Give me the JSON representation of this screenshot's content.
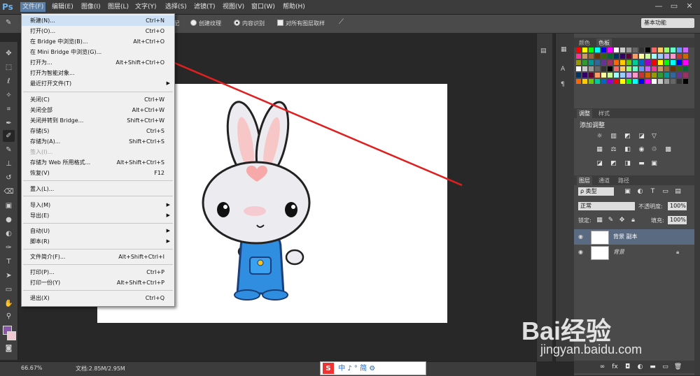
{
  "app": {
    "logo": "Ps"
  },
  "menubar": {
    "items": [
      "文件(F)",
      "编辑(E)",
      "图像(I)",
      "图层(L)",
      "文字(Y)",
      "选择(S)",
      "滤镜(T)",
      "视图(V)",
      "窗口(W)",
      "帮助(H)"
    ]
  },
  "window_controls": {
    "minimize": "—",
    "restore": "▭",
    "close": "✕"
  },
  "options": {
    "opt1": "配",
    "opt2": "创建纹理",
    "opt3": "内容识别",
    "opt4": "对所有图层取样",
    "workspace": "基本功能"
  },
  "file_menu": {
    "items": [
      {
        "label": "新建(N)...",
        "shortcut": "Ctrl+N"
      },
      {
        "label": "打开(O)...",
        "shortcut": "Ctrl+O"
      },
      {
        "label": "在 Bridge 中浏览(B)...",
        "shortcut": "Alt+Ctrl+O"
      },
      {
        "label": "在 Mini Bridge 中浏览(G)...",
        "shortcut": ""
      },
      {
        "label": "打开为...",
        "shortcut": "Alt+Shift+Ctrl+O"
      },
      {
        "label": "打开为智能对象...",
        "shortcut": ""
      },
      {
        "label": "最近打开文件(T)",
        "shortcut": ""
      },
      {
        "label": "关闭(C)",
        "shortcut": "Ctrl+W"
      },
      {
        "label": "关闭全部",
        "shortcut": "Alt+Ctrl+W"
      },
      {
        "label": "关闭并转到 Bridge...",
        "shortcut": "Shift+Ctrl+W"
      },
      {
        "label": "存储(S)",
        "shortcut": "Ctrl+S"
      },
      {
        "label": "存储为(A)...",
        "shortcut": "Shift+Ctrl+S"
      },
      {
        "label": "签入(I)...",
        "shortcut": ""
      },
      {
        "label": "存储为 Web 所用格式...",
        "shortcut": "Alt+Shift+Ctrl+S"
      },
      {
        "label": "恢复(V)",
        "shortcut": "F12"
      },
      {
        "label": "置入(L)...",
        "shortcut": ""
      },
      {
        "label": "导入(M)",
        "shortcut": ""
      },
      {
        "label": "导出(E)",
        "shortcut": ""
      },
      {
        "label": "自动(U)",
        "shortcut": ""
      },
      {
        "label": "脚本(R)",
        "shortcut": ""
      },
      {
        "label": "文件简介(F)...",
        "shortcut": "Alt+Shift+Ctrl+I"
      },
      {
        "label": "打印(P)...",
        "shortcut": "Ctrl+P"
      },
      {
        "label": "打印一份(Y)",
        "shortcut": "Alt+Shift+Ctrl+P"
      },
      {
        "label": "退出(X)",
        "shortcut": "Ctrl+Q"
      }
    ]
  },
  "panels": {
    "color_tabs": [
      "颜色",
      "色板"
    ],
    "adjust_tabs": [
      "调整",
      "样式"
    ],
    "adjust_title": "添加调整",
    "layers_tabs": [
      "图层",
      "通道",
      "路径"
    ],
    "filter_kind": "ρ 类型",
    "blend_mode": "正常",
    "opacity_label": "不透明度:",
    "opacity_value": "100%",
    "lock_label": "锁定:",
    "fill_label": "填充:",
    "fill_value": "100%",
    "layers": [
      {
        "name": "背景 副本"
      },
      {
        "name": "背景"
      }
    ],
    "swatch_colors": [
      "#ff0000",
      "#ffff00",
      "#00ff00",
      "#00ffff",
      "#0000ff",
      "#ff00ff",
      "#ffffff",
      "#cccccc",
      "#999999",
      "#666666",
      "#333333",
      "#000000",
      "#ff6666",
      "#ffcc66",
      "#99ff66",
      "#66ffcc",
      "#6699ff",
      "#cc66ff",
      "#ff3399",
      "#cc9966",
      "#996633",
      "#663300",
      "#336600",
      "#006633",
      "#003366",
      "#330066",
      "#660033",
      "#ff9966",
      "#ffff99",
      "#ccff99",
      "#99ffff",
      "#99ccff",
      "#cc99ff",
      "#ff99cc",
      "#cc3333",
      "#cc6600",
      "#999900",
      "#339933",
      "#009999",
      "#336699",
      "#663399",
      "#993366",
      "#ff6600",
      "#ffcc00",
      "#66cc00",
      "#00cc99",
      "#0066cc",
      "#9900cc"
    ]
  },
  "status": {
    "zoom": "66.67%",
    "doc": "文档:2.85M/2.95M"
  },
  "watermark": {
    "brand": "Bai经验",
    "url": "jingyan.baidu.com"
  },
  "ime": {
    "text": "中 ♪ ° 简 ⚙"
  }
}
